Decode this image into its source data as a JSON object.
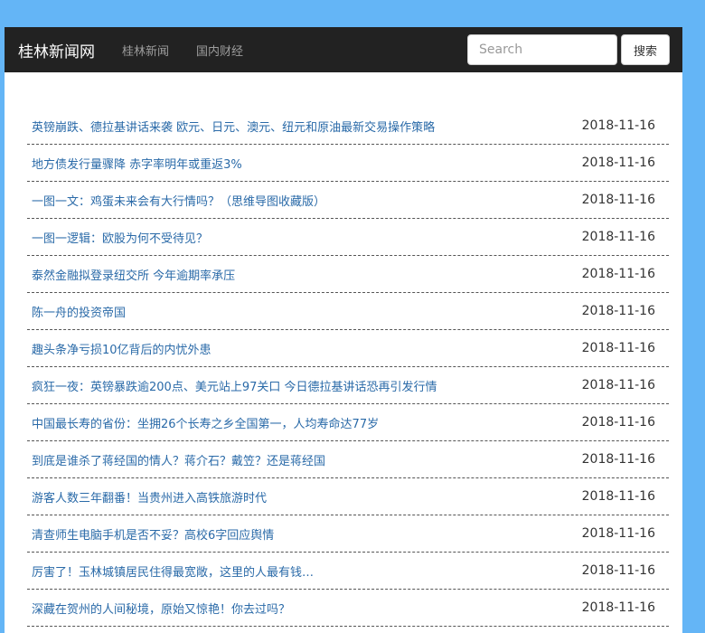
{
  "navbar": {
    "brand": "桂林新闻网",
    "links": [
      "桂林新闻",
      "国内财经"
    ],
    "search_placeholder": "Search",
    "search_button": "搜索"
  },
  "news": [
    {
      "title": "英镑崩跌、德拉基讲话来袭 欧元、日元、澳元、纽元和原油最新交易操作策略",
      "date": "2018-11-16"
    },
    {
      "title": "地方债发行量骤降 赤字率明年或重返3%",
      "date": "2018-11-16"
    },
    {
      "title": "一图一文：鸡蛋未来会有大行情吗？（思维导图收藏版）",
      "date": "2018-11-16"
    },
    {
      "title": "一图一逻辑：欧股为何不受待见？",
      "date": "2018-11-16"
    },
    {
      "title": "泰然金融拟登录纽交所 今年逾期率承压",
      "date": "2018-11-16"
    },
    {
      "title": "陈一舟的投资帝国",
      "date": "2018-11-16"
    },
    {
      "title": "趣头条净亏损10亿背后的内忧外患",
      "date": "2018-11-16"
    },
    {
      "title": "疯狂一夜：英镑暴跌逾200点、美元站上97关口 今日德拉基讲话恐再引发行情",
      "date": "2018-11-16"
    },
    {
      "title": "中国最长寿的省份：坐拥26个长寿之乡全国第一，人均寿命达77岁",
      "date": "2018-11-16"
    },
    {
      "title": "到底是谁杀了蒋经国的情人？蒋介石？戴笠？还是蒋经国",
      "date": "2018-11-16"
    },
    {
      "title": "游客人数三年翻番！当贵州进入高铁旅游时代",
      "date": "2018-11-16"
    },
    {
      "title": "清查师生电脑手机是否不妥？高校6字回应舆情",
      "date": "2018-11-16"
    },
    {
      "title": "厉害了！玉林城镇居民住得最宽敞，这里的人最有钱…",
      "date": "2018-11-16"
    },
    {
      "title": "深藏在贺州的人间秘境，原始又惊艳！你去过吗？",
      "date": "2018-11-16"
    }
  ]
}
